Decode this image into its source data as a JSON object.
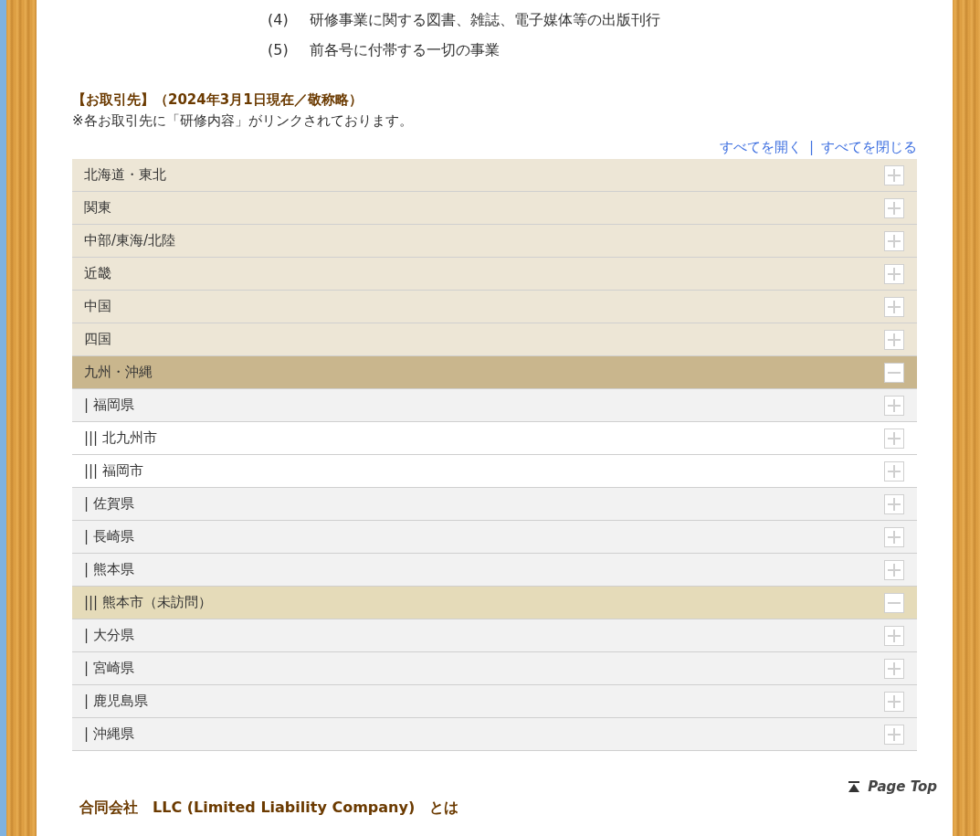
{
  "business_items": [
    {
      "number": "(4)",
      "text": "研修事業に関する図書、雑誌、電子媒体等の出版刊行"
    },
    {
      "number": "(5)",
      "text": "前各号に付帯する一切の事業"
    }
  ],
  "clients": {
    "heading": "【お取引先】（2024年3月1日現在／敬称略）",
    "note": "※各お取引先に「研修内容」がリンクされております。",
    "open_all": "すべてを開く",
    "separator": "|",
    "close_all": "すべてを閉じる",
    "regions": [
      {
        "label": "北海道・東北",
        "expanded": false
      },
      {
        "label": "関東",
        "expanded": false
      },
      {
        "label": "中部/東海/北陸",
        "expanded": false
      },
      {
        "label": "近畿",
        "expanded": false
      },
      {
        "label": "中国",
        "expanded": false
      },
      {
        "label": "四国",
        "expanded": false
      },
      {
        "label": "九州・沖縄",
        "expanded": true,
        "children": [
          {
            "label": "| 福岡県",
            "expanded": false,
            "children": [
              {
                "label": "||| 北九州市",
                "expanded": false
              },
              {
                "label": "||| 福岡市",
                "expanded": false
              }
            ]
          },
          {
            "label": "| 佐賀県",
            "expanded": false
          },
          {
            "label": "| 長崎県",
            "expanded": false
          },
          {
            "label": "| 熊本県",
            "expanded": false,
            "children": [
              {
                "label": "||| 熊本市（未訪問）",
                "expanded": true
              }
            ]
          },
          {
            "label": "| 大分県",
            "expanded": false
          },
          {
            "label": "| 宮崎県",
            "expanded": false
          },
          {
            "label": "| 鹿児島県",
            "expanded": false
          },
          {
            "label": "| 沖縄県",
            "expanded": false
          }
        ]
      }
    ]
  },
  "page_top": "Page Top",
  "llc_heading": "合同会社　LLC (Limited Liability Company)　とは"
}
